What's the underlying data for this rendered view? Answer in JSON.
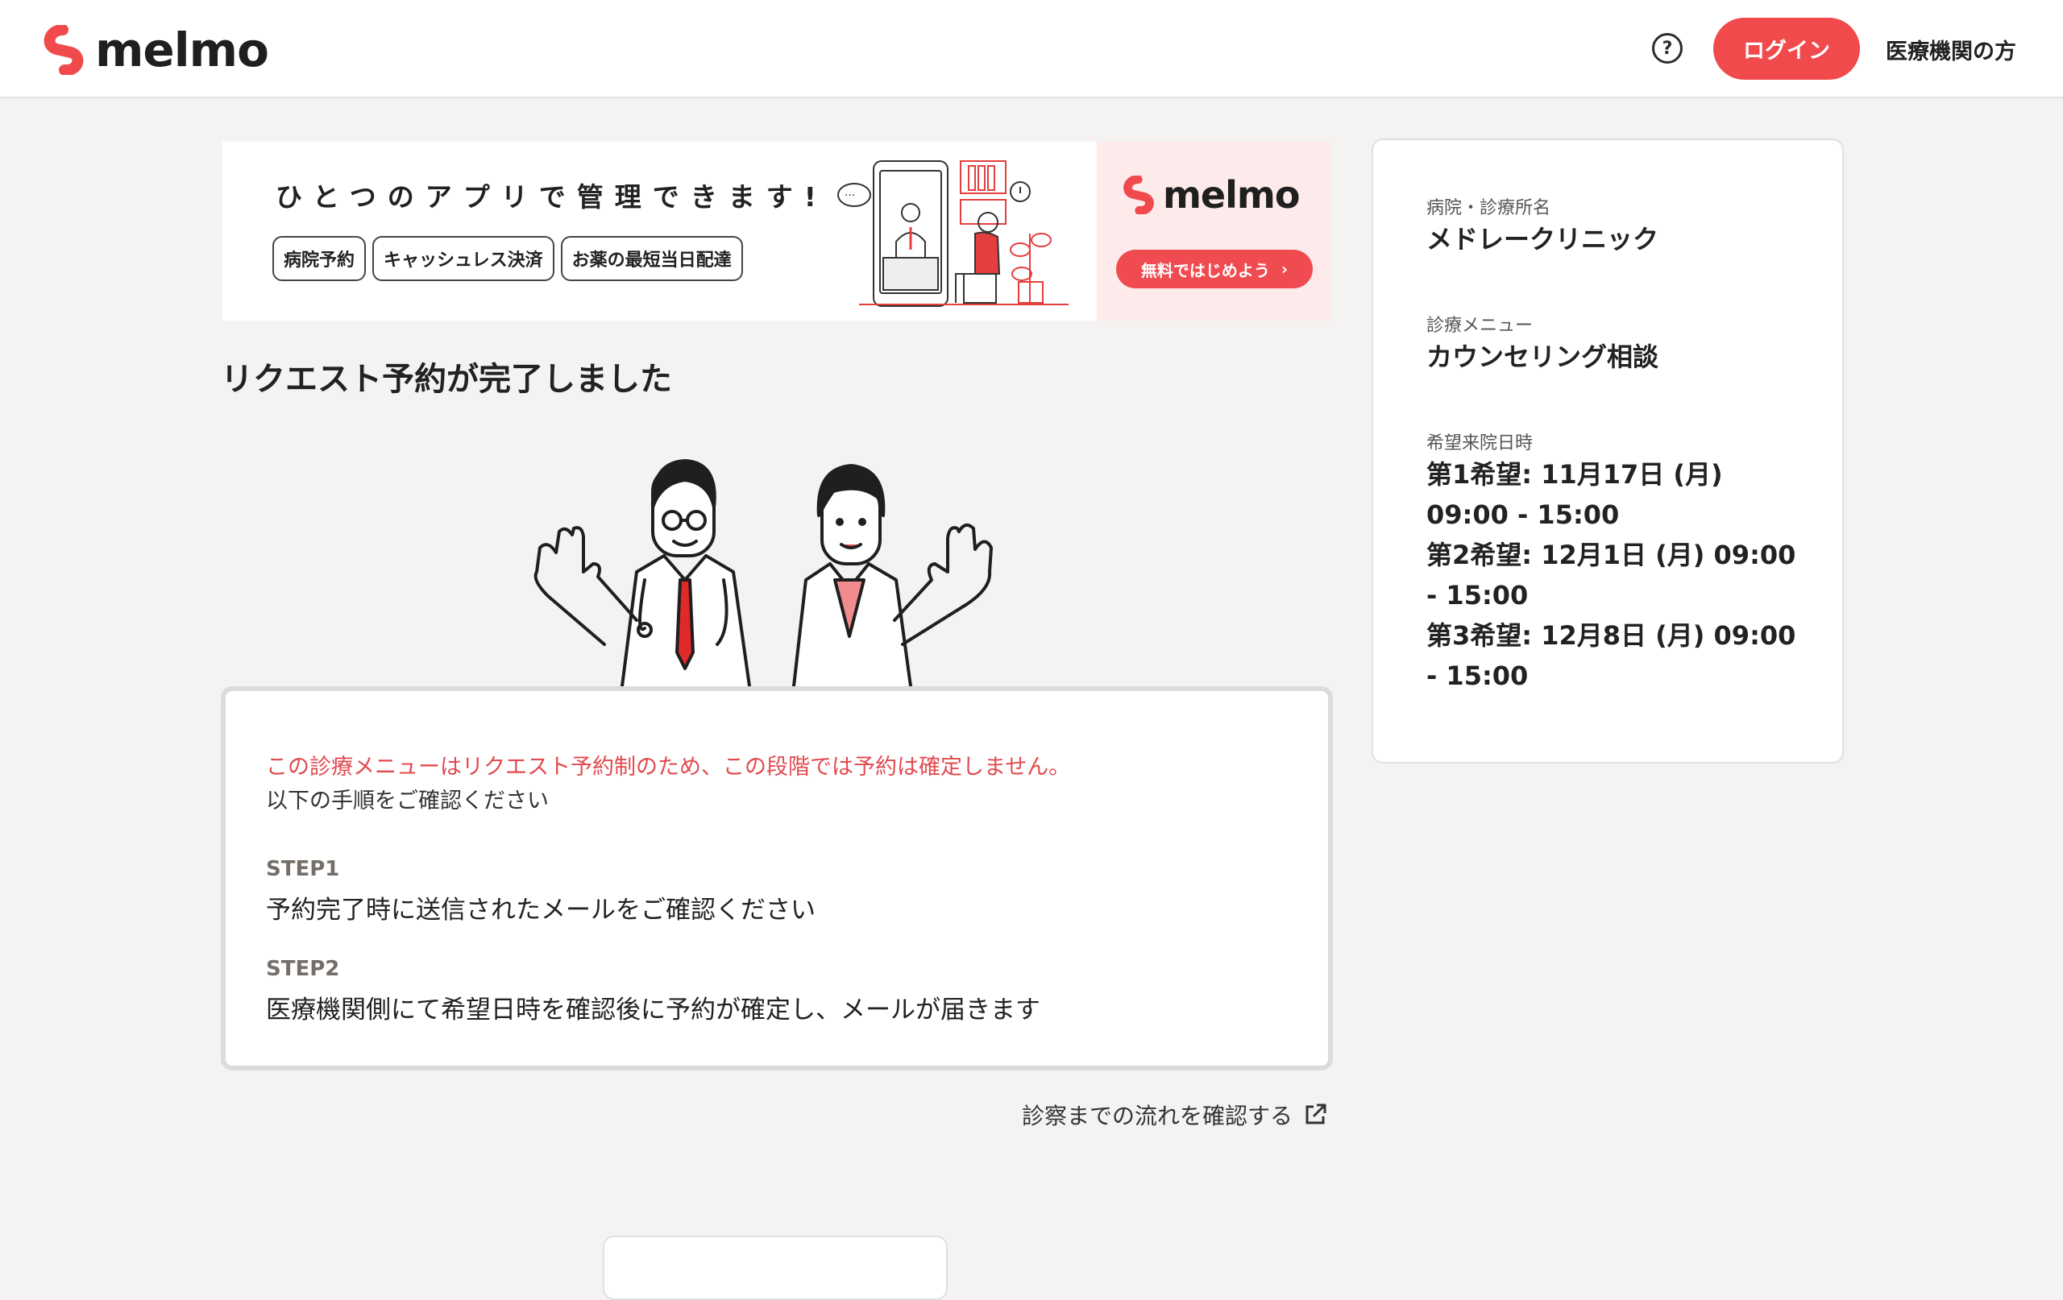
{
  "header": {
    "logo_text": "melmo",
    "help_icon": "question-circle-icon",
    "login_label": "ログイン",
    "medical_link": "医療機関の方"
  },
  "banner": {
    "headline": "ひとつのアプリで管理できます!",
    "tags": [
      "病院予約",
      "キャッシュレス決済",
      "お薬の最短当日配達"
    ],
    "logo_text": "melmo",
    "cta_label": "無料ではじめよう",
    "cta_icon": "chevron-right-icon"
  },
  "main": {
    "title": "リクエスト予約が完了しました",
    "notice_red": "この診療メニューはリクエスト予約制のため、この段階では予約は確定しません。",
    "notice_sub": "以下の手順をご確認ください",
    "steps": [
      {
        "label": "STEP1",
        "text": "予約完了時に送信されたメールをご確認ください"
      },
      {
        "label": "STEP2",
        "text": "医療機関側にて希望日時を確認後に予約が確定し、メールが届きます"
      }
    ],
    "flow_link": "診察までの流れを確認する",
    "flow_link_icon": "external-link-icon"
  },
  "side": {
    "clinic_label": "病院・診療所名",
    "clinic_name": "メドレークリニック",
    "menu_label": "診療メニュー",
    "menu_name": "カウンセリング相談",
    "dates_label": "希望来院日時",
    "dates": [
      "第1希望: 11月17日 (月) 09:00 - 15:00",
      "第2希望: 12月1日 (月) 09:00 - 15:00",
      "第3希望: 12月8日 (月) 09:00 - 15:00"
    ]
  },
  "colors": {
    "brand_red": "#f04a4d",
    "page_bg": "#f5f3f2",
    "notice_red": "#e24a4f"
  }
}
